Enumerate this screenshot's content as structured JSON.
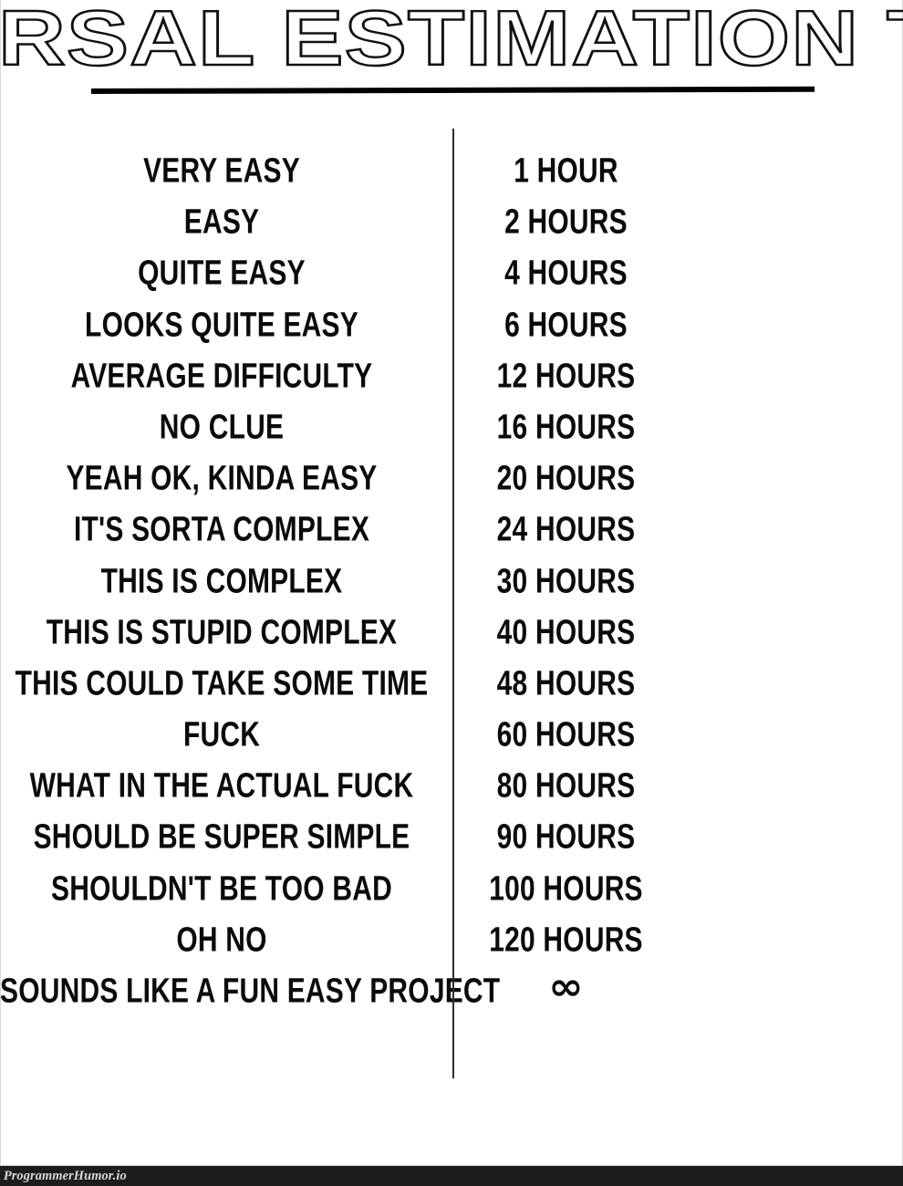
{
  "header": {
    "title": "UNIVERSAL ESTIMATION TABLE",
    "rule_color": "#000000"
  },
  "colors": {
    "background": "#ffffff",
    "text": "#0b0b0b",
    "divider": "#2e2e33",
    "watermark_bar": "#1d1d1d",
    "watermark_text": "#d8d8d8",
    "page_border": "#d7d7d7"
  },
  "table": {
    "columns": [
      "difficulty",
      "estimate"
    ],
    "rows": [
      {
        "difficulty": "VERY EASY",
        "estimate": "1 HOUR"
      },
      {
        "difficulty": "EASY",
        "estimate": "2 HOURS"
      },
      {
        "difficulty": "QUITE EASY",
        "estimate": "4 HOURS"
      },
      {
        "difficulty": "LOOKS QUITE EASY",
        "estimate": "6 HOURS"
      },
      {
        "difficulty": "AVERAGE DIFFICULTY",
        "estimate": "12 HOURS"
      },
      {
        "difficulty": "NO CLUE",
        "estimate": "16 HOURS"
      },
      {
        "difficulty": "YEAH OK, KINDA EASY",
        "estimate": "20 HOURS"
      },
      {
        "difficulty": "IT'S SORTA COMPLEX",
        "estimate": "24 HOURS"
      },
      {
        "difficulty": "THIS IS COMPLEX",
        "estimate": "30 HOURS"
      },
      {
        "difficulty": "THIS IS STUPID COMPLEX",
        "estimate": "40 HOURS"
      },
      {
        "difficulty": "THIS COULD TAKE SOME TIME",
        "estimate": "48 HOURS"
      },
      {
        "difficulty": "FUCK",
        "estimate": "60 HOURS"
      },
      {
        "difficulty": "WHAT IN THE ACTUAL FUCK",
        "estimate": "80 HOURS"
      },
      {
        "difficulty": "SHOULD BE SUPER SIMPLE",
        "estimate": "90 HOURS"
      },
      {
        "difficulty": "SHOULDN'T BE TOO BAD",
        "estimate": "100 HOURS"
      },
      {
        "difficulty": "OH NO",
        "estimate": "120 HOURS"
      },
      {
        "difficulty": "SOUNDS LIKE A FUN EASY PROJECT",
        "estimate": "∞"
      }
    ]
  },
  "watermark": {
    "label": "ProgrammerHumor.io"
  }
}
